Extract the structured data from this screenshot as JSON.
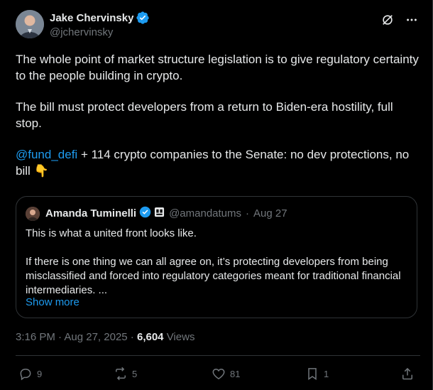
{
  "author": {
    "display_name": "Jake Chervinsky",
    "handle": "@jchervinsky"
  },
  "tweet": {
    "paragraph_1": "The whole point of market structure legislation is to give regulatory certainty to the people building in crypto.",
    "paragraph_2": "The bill must protect developers from a return to Biden-era hostility, full stop.",
    "mention": "@fund_defi",
    "paragraph_3_rest": " + 114 crypto companies to the Senate: no dev protections, no bill 👇"
  },
  "quote": {
    "display_name": "Amanda Tuminelli",
    "handle": "@amandatums",
    "separator": "·",
    "date": "Aug 27",
    "paragraph_1": "This is what a united front looks like.",
    "paragraph_2": "If there is one thing we can all agree on, it’s protecting developers from being misclassified and forced into regulatory categories meant for traditional financial intermediaries. ...",
    "show_more": "Show more"
  },
  "meta": {
    "time": "3:16 PM",
    "separator": " · ",
    "date": "Aug 27, 2025",
    "views_count": "6,604",
    "views_label": " Views"
  },
  "actions": {
    "replies": "9",
    "reposts": "5",
    "likes": "81",
    "bookmarks": "1"
  },
  "colors": {
    "background": "#000000",
    "text": "#e7e9ea",
    "muted": "#71767b",
    "accent": "#1d9bf0",
    "border": "#2f3336"
  }
}
